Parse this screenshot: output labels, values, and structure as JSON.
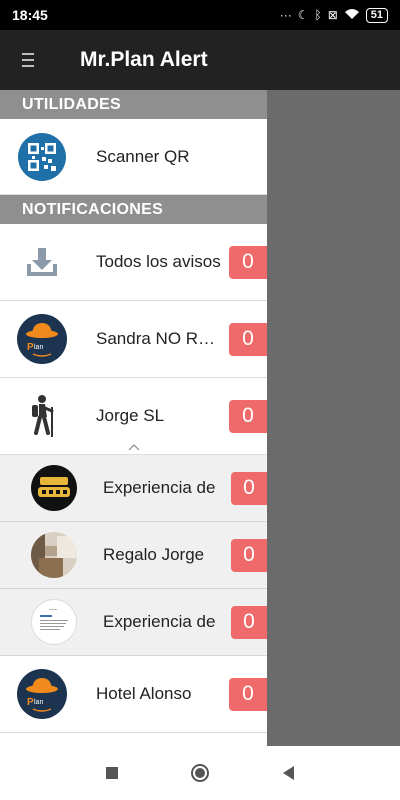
{
  "status_bar": {
    "time": "18:45",
    "battery": "51"
  },
  "app_bar": {
    "title": "Mr.Plan Alert"
  },
  "drawer": {
    "utilities_header": "UTILIDADES",
    "utilities": [
      {
        "label": "Scanner QR",
        "icon": "qr-code-icon"
      }
    ],
    "notifications_header": "NOTIFICACIONES",
    "notifications": [
      {
        "label": "Todos los avisos",
        "count": "0",
        "icon": "download-icon"
      },
      {
        "label": "Sandra NO RESPONDE",
        "count": "0",
        "icon": "plan-logo-icon"
      },
      {
        "label": "Jorge SL",
        "count": "0",
        "icon": "hiker-icon"
      }
    ],
    "subitems": [
      {
        "label": "Experiencia de",
        "count": "0",
        "icon": "experience-thumbnail"
      },
      {
        "label": "Regalo Jorge",
        "count": "0",
        "icon": "gift-photo-thumbnail"
      },
      {
        "label": "Experiencia de",
        "count": "0",
        "icon": "document-thumbnail"
      }
    ],
    "more": [
      {
        "label": "Hotel Alonso",
        "count": "0",
        "icon": "plan-logo-icon"
      }
    ]
  },
  "colors": {
    "badge": "#ef6b6b",
    "app_bar": "#222222",
    "section_header": "#8f8f8f",
    "logo_bg": "#1d3450",
    "hat": "#f08a1c"
  }
}
